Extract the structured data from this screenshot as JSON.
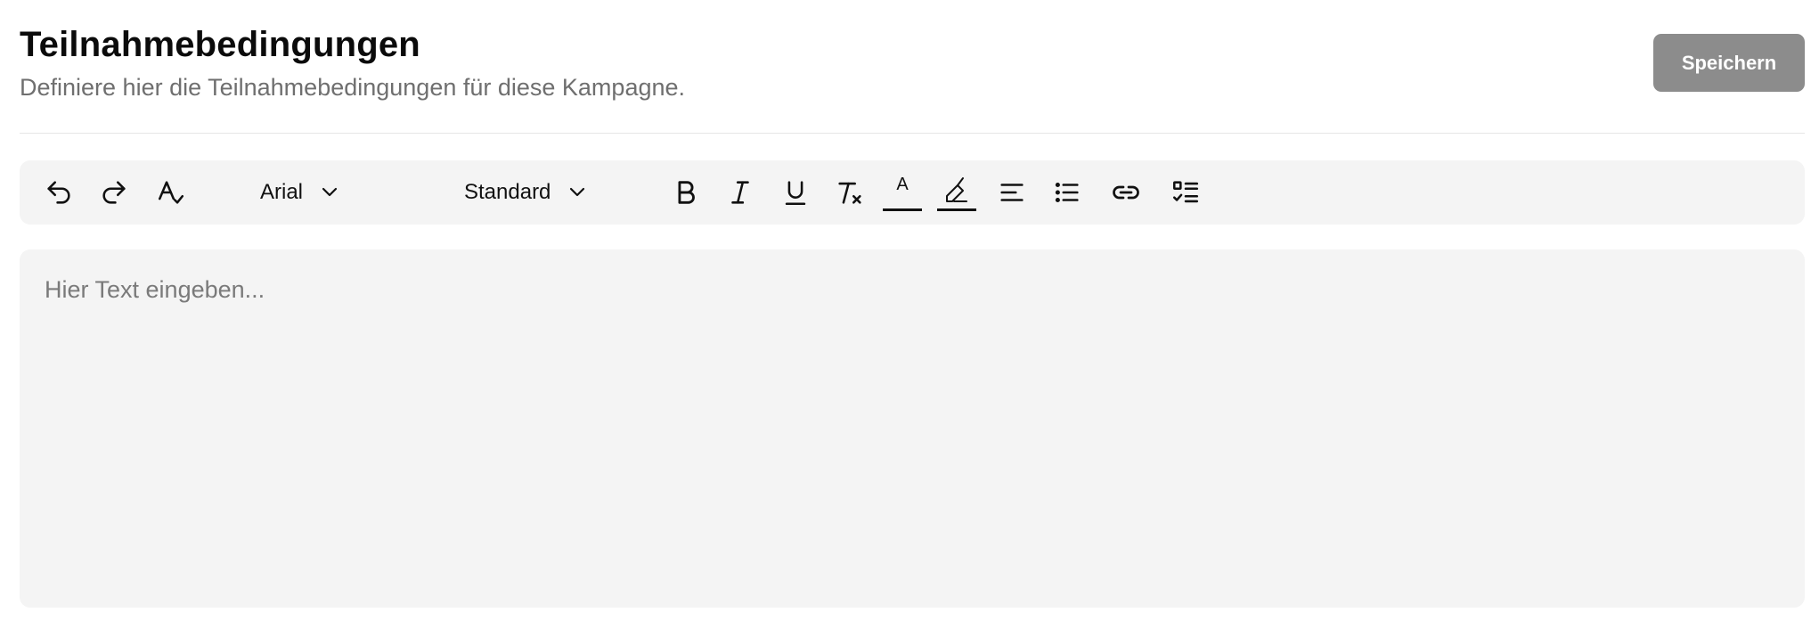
{
  "header": {
    "title": "Teilnahmebedingungen",
    "subtitle": "Definiere hier die Teilnahmebedingungen für diese Kampagne.",
    "save_label": "Speichern",
    "save_color": "#8c8c8c"
  },
  "toolbar": {
    "font_family": "Arial",
    "text_style": "Standard",
    "icons": [
      "undo-icon",
      "redo-icon",
      "spellcheck-icon",
      "bold-icon",
      "italic-icon",
      "underline-icon",
      "clear-formatting-icon",
      "text-color-icon",
      "highlight-color-icon",
      "align-left-icon",
      "bullet-list-icon",
      "link-icon",
      "checklist-icon"
    ],
    "background": "#f4f4f4"
  },
  "editor": {
    "placeholder": "Hier Text eingeben...",
    "value": ""
  }
}
